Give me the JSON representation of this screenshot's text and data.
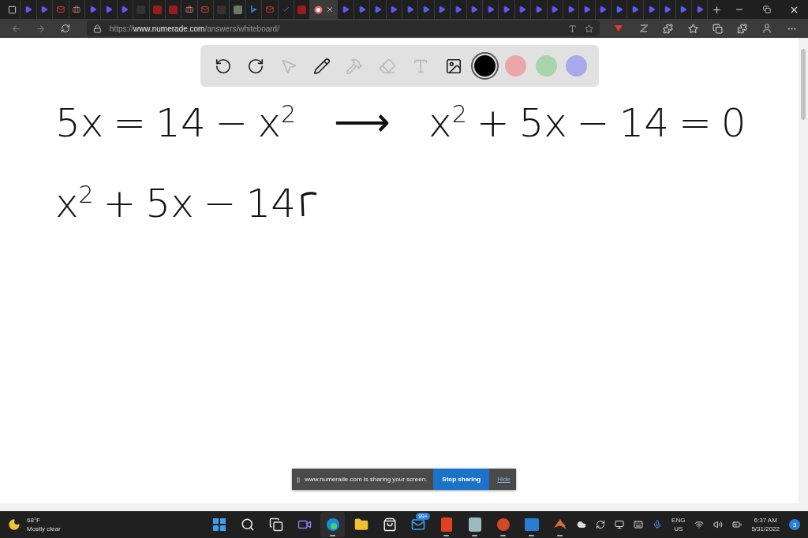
{
  "browser": {
    "tabs": [
      {
        "kind": "play",
        "selected": false
      },
      {
        "kind": "play",
        "selected": false
      },
      {
        "kind": "gmail",
        "selected": false
      },
      {
        "kind": "bag",
        "selected": false
      },
      {
        "kind": "play",
        "selected": false
      },
      {
        "kind": "play",
        "selected": false
      },
      {
        "kind": "play",
        "selected": false
      },
      {
        "kind": "blank",
        "selected": false
      },
      {
        "kind": "wolf",
        "selected": false
      },
      {
        "kind": "wolf",
        "selected": false
      },
      {
        "kind": "bag",
        "selected": false
      },
      {
        "kind": "gmail",
        "selected": false
      },
      {
        "kind": "blank",
        "selected": false
      },
      {
        "kind": "box",
        "selected": false
      },
      {
        "kind": "bing",
        "selected": false
      },
      {
        "kind": "gmail",
        "selected": false
      },
      {
        "kind": "check",
        "selected": false
      },
      {
        "kind": "wolf",
        "selected": false
      },
      {
        "kind": "record",
        "selected": true
      },
      {
        "kind": "play",
        "selected": false
      },
      {
        "kind": "play",
        "selected": false
      },
      {
        "kind": "play",
        "selected": false
      },
      {
        "kind": "play",
        "selected": false
      },
      {
        "kind": "play",
        "selected": false
      },
      {
        "kind": "play",
        "selected": false
      },
      {
        "kind": "play",
        "selected": false
      },
      {
        "kind": "play",
        "selected": false
      },
      {
        "kind": "play",
        "selected": false
      },
      {
        "kind": "play",
        "selected": false
      },
      {
        "kind": "play",
        "selected": false
      },
      {
        "kind": "play",
        "selected": false
      },
      {
        "kind": "play",
        "selected": false
      },
      {
        "kind": "play",
        "selected": false
      },
      {
        "kind": "play",
        "selected": false
      },
      {
        "kind": "play",
        "selected": false
      },
      {
        "kind": "play",
        "selected": false
      },
      {
        "kind": "play",
        "selected": false
      },
      {
        "kind": "play",
        "selected": false
      },
      {
        "kind": "play",
        "selected": false
      },
      {
        "kind": "play",
        "selected": false
      },
      {
        "kind": "play",
        "selected": false
      },
      {
        "kind": "play",
        "selected": false
      }
    ],
    "url_scheme": "https://",
    "url_host": "www.numerade.com",
    "url_path": "/answers/whiteboard/"
  },
  "whiteboard": {
    "tools": [
      {
        "kind": "undo",
        "disabled": false
      },
      {
        "kind": "redo",
        "disabled": false
      },
      {
        "kind": "pointer",
        "disabled": true
      },
      {
        "kind": "pen",
        "disabled": false
      },
      {
        "kind": "tools",
        "disabled": true
      },
      {
        "kind": "eraser",
        "disabled": true
      },
      {
        "kind": "text",
        "disabled": true
      },
      {
        "kind": "image",
        "disabled": false
      }
    ],
    "colors": [
      {
        "color": "#000000",
        "selected": true
      },
      {
        "color": "#eaa7a7",
        "selected": false
      },
      {
        "color": "#a9d3a9",
        "selected": false
      },
      {
        "color": "#a9a9ea",
        "selected": false
      }
    ],
    "lines": [
      {
        "left": "5x = 14 − x$^{2}$",
        "arrow": "⟶",
        "right": "x$^{2}$ + 5x − 14 = 0"
      },
      {
        "left": "x$^{2}$ + 5x − 14",
        "unfinished": true
      }
    ]
  },
  "share_bar": {
    "handle": "||",
    "message": "www.numerade.com is sharing your screen.",
    "stop": "Stop sharing",
    "hide": "Hide"
  },
  "taskbar": {
    "temperature": "68°F",
    "weather": "Mostly clear",
    "apps": [
      {
        "kind": "start",
        "running": false
      },
      {
        "kind": "search",
        "running": false
      },
      {
        "kind": "taskview",
        "running": false
      },
      {
        "kind": "chat",
        "running": false
      },
      {
        "kind": "edge",
        "running": true
      },
      {
        "kind": "folder",
        "running": false
      },
      {
        "kind": "store",
        "running": false
      },
      {
        "kind": "mail",
        "running": false,
        "badge": "99+"
      },
      {
        "kind": "office",
        "running": true
      },
      {
        "kind": "cube",
        "running": true
      },
      {
        "kind": "powerpoint",
        "running": true
      },
      {
        "kind": "word",
        "running": true
      },
      {
        "kind": "matlab",
        "running": true
      }
    ],
    "language": "ENG",
    "region": "US",
    "time": "6:37 AM",
    "date": "5/31/2022",
    "notifications": "3"
  }
}
